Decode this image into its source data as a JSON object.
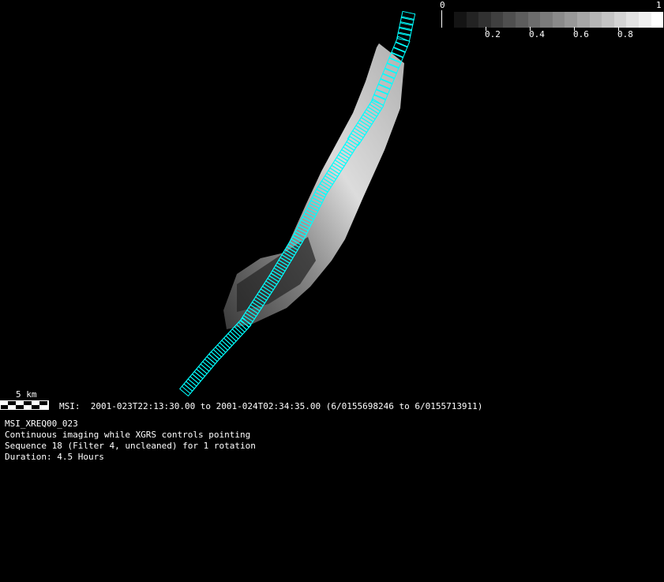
{
  "colorbar": {
    "min_label": "0",
    "max_label": "1",
    "tick_labels": [
      "0.2",
      "0.4",
      "0.6",
      "0.8"
    ],
    "steps": 17
  },
  "scale_bar": {
    "label": "5 km"
  },
  "info": {
    "time_line": "MSI:  2001-023T22:13:30.00 to 2001-024T02:34:35.00 (6/0155698246 to 6/0155713911)",
    "sequence_id": "MSI_XREQ00_023",
    "description": "Continuous imaging while XGRS controls pointing",
    "sequence": "Sequence 18 (Filter 4, uncleaned) for 1 rotation",
    "duration": "Duration: 4.5 Hours"
  },
  "colors": {
    "footprint": "#00ffff",
    "background": "#000000"
  }
}
